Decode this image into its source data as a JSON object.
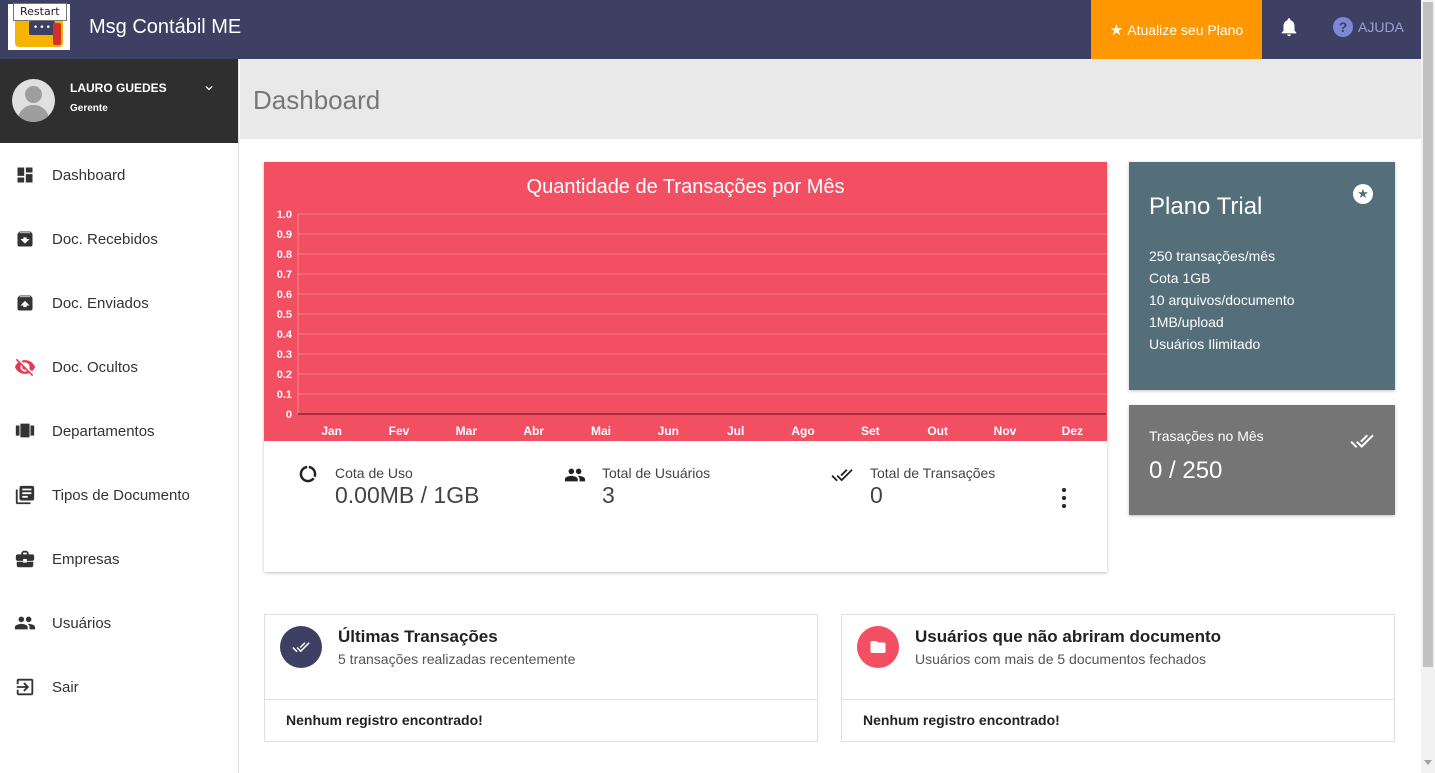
{
  "header": {
    "tooltip": "Restart",
    "app_title": "Msg Contábil ME",
    "upgrade_label": "Atualize seu Plano",
    "help_label": "AJUDA"
  },
  "user": {
    "name": "LAURO GUEDES",
    "role": "Gerente"
  },
  "sidebar": {
    "items": [
      {
        "label": "Dashboard",
        "icon": "dashboard-icon"
      },
      {
        "label": "Doc. Recebidos",
        "icon": "inbox-download-icon"
      },
      {
        "label": "Doc. Enviados",
        "icon": "inbox-upload-icon"
      },
      {
        "label": "Doc. Ocultos",
        "icon": "eye-off-icon"
      },
      {
        "label": "Departamentos",
        "icon": "view-carousel-icon"
      },
      {
        "label": "Tipos de Documento",
        "icon": "library-books-icon"
      },
      {
        "label": "Empresas",
        "icon": "briefcase-icon"
      },
      {
        "label": "Usuários",
        "icon": "people-icon"
      },
      {
        "label": "Sair",
        "icon": "exit-icon"
      }
    ]
  },
  "page": {
    "title": "Dashboard"
  },
  "chart_data": {
    "type": "line",
    "title": "Quantidade de Transações por Mês",
    "categories": [
      "Jan",
      "Fev",
      "Mar",
      "Abr",
      "Mai",
      "Jun",
      "Jul",
      "Ago",
      "Set",
      "Out",
      "Nov",
      "Dez"
    ],
    "values": [
      0,
      0,
      0,
      0,
      0,
      0,
      0,
      0,
      0,
      0,
      0,
      0
    ],
    "yticks": [
      "1.0",
      "0.9",
      "0.8",
      "0.7",
      "0.6",
      "0.5",
      "0.4",
      "0.3",
      "0.2",
      "0.1",
      "0"
    ],
    "ylim": [
      0,
      1
    ],
    "grid": true,
    "background": "#f25062",
    "line_color": "#a3303d"
  },
  "stats": {
    "quota_label": "Cota de Uso",
    "quota_value": "0.00MB / 1GB",
    "users_label": "Total de Usuários",
    "users_value": "3",
    "tx_label": "Total de Transações",
    "tx_value": "0"
  },
  "plan": {
    "title": "Plano Trial",
    "features": [
      "250 transações/mês",
      "Cota 1GB",
      "10 arquivos/documento",
      "1MB/upload",
      "Usuários Ilimitado"
    ]
  },
  "monthly_tx": {
    "label": "Trasações no Mês",
    "value": "0 / 250"
  },
  "recent": {
    "title": "Últimas Transações",
    "subtitle": "5 transações realizadas recentemente",
    "empty": "Nenhum registro encontrado!"
  },
  "unopened": {
    "title": "Usuários que não abriram documento",
    "subtitle": "Usuários com mais de 5 documentos fechados",
    "empty": "Nenhum registro encontrado!"
  },
  "colors": {
    "topbar": "#3d4063",
    "upgrade": "#ff9800",
    "chart_bg": "#f25062",
    "plan_card": "#546e7a",
    "tx_card": "#757575"
  }
}
